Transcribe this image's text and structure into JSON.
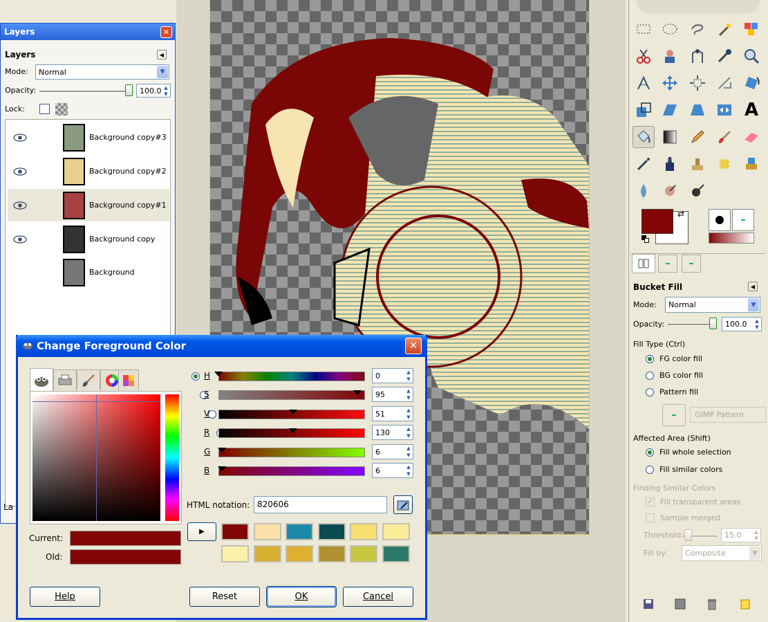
{
  "layers": {
    "window_title": "Layers",
    "panel_title": "Layers",
    "mode_label": "Mode:",
    "mode_value": "Normal",
    "opacity_label": "Opacity:",
    "opacity_value": "100.0",
    "lock_label": "Lock:",
    "items": [
      {
        "name": "Background copy#3",
        "visible": true,
        "selected": false
      },
      {
        "name": "Background copy#2",
        "visible": true,
        "selected": false
      },
      {
        "name": "Background copy#1",
        "visible": true,
        "selected": true
      },
      {
        "name": "Background copy",
        "visible": true,
        "selected": false
      },
      {
        "name": "Background",
        "visible": false,
        "selected": false
      }
    ],
    "cut_label": "La"
  },
  "dialog": {
    "title": "Change Foreground Color",
    "channels": [
      {
        "letter": "H",
        "value": "0",
        "selected": true
      },
      {
        "letter": "S",
        "value": "95",
        "selected": false
      },
      {
        "letter": "V",
        "value": "51",
        "selected": false
      },
      {
        "letter": "R",
        "value": "130",
        "selected": false
      },
      {
        "letter": "G",
        "value": "6",
        "selected": false
      },
      {
        "letter": "B",
        "value": "6",
        "selected": false
      }
    ],
    "html_label": "HTML notation:",
    "html_value": "820606",
    "current_label": "Current:",
    "old_label": "Old:",
    "current_color": "#820606",
    "old_color": "#820606",
    "history_colors": [
      "#820606",
      "#fbe0a8",
      "#1a8aa8",
      "#0a4a52",
      "#f8e070",
      "#f8ec98",
      "#fcefa8",
      "#d8b030",
      "#e0b030",
      "#b09030",
      "#c8c840",
      "#2a7a6a"
    ],
    "buttons": {
      "help": "Help",
      "reset": "Reset",
      "ok": "OK",
      "cancel": "Cancel"
    }
  },
  "toolbox": {
    "fg_color": "#820606",
    "bg_color": "#ffffff",
    "options_title": "Bucket Fill",
    "mode_label": "Mode:",
    "mode_value": "Normal",
    "opacity_label": "Opacity:",
    "opacity_value": "100.0",
    "fill_type_label": "Fill Type  (Ctrl)",
    "fill_types": [
      "FG color fill",
      "BG color fill",
      "Pattern fill"
    ],
    "fill_type_selected": 0,
    "pattern_name": "GIMP Pattern",
    "affected_label": "Affected Area  (Shift)",
    "affected_options": [
      "Fill whole selection",
      "Fill similar colors"
    ],
    "affected_selected": 0,
    "finding_label": "Finding Similar Colors",
    "fill_transparent": "Fill transparent areas",
    "sample_merged": "Sample merged",
    "threshold_label": "Threshold:",
    "threshold_value": "15.0",
    "fill_by_label": "Fill by:",
    "fill_by_value": "Composite"
  }
}
